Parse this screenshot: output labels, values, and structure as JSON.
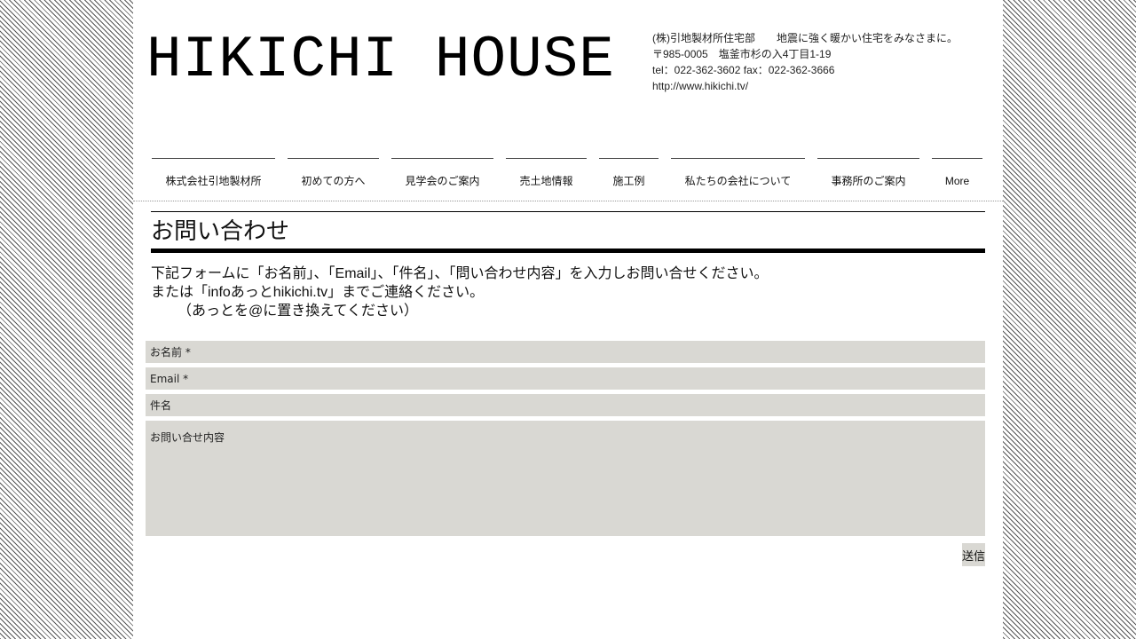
{
  "header": {
    "site_title": "HIKICHI HOUSE",
    "info": {
      "company": "(株)引地製材所住宅部",
      "tagline": "地震に強く暖かい住宅をみなさまに。",
      "address": "〒985-0005　塩釜市杉の入4丁目1-19",
      "phone": "tel：022-362-3602 fax：022-362-3666",
      "url": "http://www.hikichi.tv/"
    }
  },
  "nav": {
    "items": [
      {
        "label": "株式会社引地製材所"
      },
      {
        "label": "初めての方へ"
      },
      {
        "label": "見学会のご案内"
      },
      {
        "label": "売土地情報"
      },
      {
        "label": "施工例"
      },
      {
        "label": "私たちの会社について"
      },
      {
        "label": "事務所のご案内"
      },
      {
        "label": "More"
      }
    ]
  },
  "content": {
    "title": "お問い合わせ",
    "intro": [
      "下記フォームに「お名前」、「Email」、「件名」、「問い合わせ内容」を入力しお問い合せください。",
      "または「infoあっとhikichi.tv」までご連絡ください。",
      "（あっとを@に置き換えてください）"
    ]
  },
  "form": {
    "name_placeholder": "お名前 *",
    "email_placeholder": "Email *",
    "subject_placeholder": "件名",
    "message_placeholder": "お問い合せ内容",
    "submit_label": "送信"
  }
}
